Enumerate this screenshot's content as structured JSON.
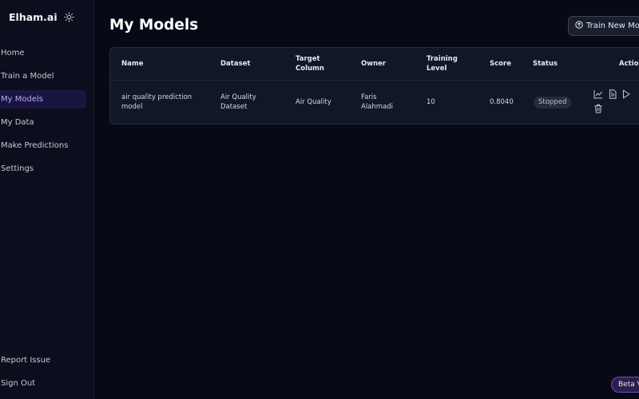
{
  "app": {
    "brand": "Elham.ai"
  },
  "sidebar": {
    "items": [
      {
        "label": "Home"
      },
      {
        "label": "Train a Model"
      },
      {
        "label": "My Models"
      },
      {
        "label": "My Data"
      },
      {
        "label": "Make Predictions"
      },
      {
        "label": "Settings"
      }
    ],
    "bottom": [
      {
        "label": "Report Issue"
      },
      {
        "label": "Sign Out"
      }
    ],
    "active": "My Models"
  },
  "main": {
    "title": "My Models",
    "train_button": "Train New Model"
  },
  "table": {
    "headers": {
      "name": "Name",
      "dataset": "Dataset",
      "target_line1": "Target",
      "target_line2": "Column",
      "owner": "Owner",
      "training_line1": "Training",
      "training_line2": "Level",
      "score": "Score",
      "status": "Status",
      "actions": "Actions"
    },
    "rows": [
      {
        "name_line1": "air quality prediction",
        "name_line2": "model",
        "dataset_line1": "Air Quality",
        "dataset_line2": "Dataset",
        "target": "Air Quality",
        "owner_line1": "Faris",
        "owner_line2": "Alahmadi",
        "training_level": "10",
        "score": "0.8040",
        "status": "Stopped"
      }
    ]
  },
  "badge": {
    "label": "Beta Version"
  },
  "icons": [
    "sun-icon",
    "upload-icon",
    "chart-icon",
    "document-icon",
    "play-icon",
    "trash-icon"
  ],
  "colors": {
    "accent": "#b8a8f5",
    "active_bg": "#1a1540",
    "background": "#070914"
  }
}
